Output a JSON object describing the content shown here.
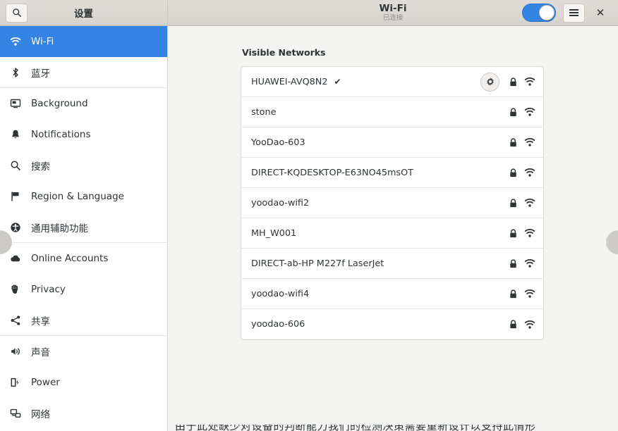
{
  "window": {
    "headerbar": {
      "sidebar_title": "设置",
      "search_icon": "search-icon",
      "title": "Wi-Fi",
      "subtitle": "已连接",
      "wifi_toggle_state": "on",
      "menu_icon": "hamburger-menu-icon",
      "close_label": "✕",
      "accent_color": "#3584e4"
    },
    "sidebar": {
      "items": [
        {
          "label": "Wi-Fi",
          "icon": "wifi-icon",
          "selected": true,
          "separator_after": false
        },
        {
          "label": "蓝牙",
          "icon": "bluetooth-icon",
          "selected": false,
          "separator_after": true
        },
        {
          "label": "Background",
          "icon": "background-icon",
          "selected": false,
          "separator_after": false
        },
        {
          "label": "Notifications",
          "icon": "bell-icon",
          "selected": false,
          "separator_after": false
        },
        {
          "label": "搜索",
          "icon": "search-icon",
          "selected": false,
          "separator_after": false
        },
        {
          "label": "Region & Language",
          "icon": "flag-icon",
          "selected": false,
          "separator_after": false
        },
        {
          "label": "通用辅助功能",
          "icon": "accessibility-icon",
          "selected": false,
          "separator_after": true
        },
        {
          "label": "Online Accounts",
          "icon": "cloud-icon",
          "selected": false,
          "separator_after": false
        },
        {
          "label": "Privacy",
          "icon": "hand-icon",
          "selected": false,
          "separator_after": false
        },
        {
          "label": "共享",
          "icon": "share-icon",
          "selected": false,
          "separator_after": true
        },
        {
          "label": "声音",
          "icon": "sound-icon",
          "selected": false,
          "separator_after": false
        },
        {
          "label": "Power",
          "icon": "power-battery-icon",
          "selected": false,
          "separator_after": false
        },
        {
          "label": "网络",
          "icon": "network-icon",
          "selected": false,
          "separator_after": false
        }
      ]
    },
    "content": {
      "section_title": "Visible Networks",
      "networks": [
        {
          "ssid": "HUAWEI-AVQ8N2",
          "connected": true,
          "check": "✔",
          "has_settings_button": true,
          "secured": true,
          "signal_icon": "wifi-signal-icon"
        },
        {
          "ssid": "stone",
          "connected": false,
          "check": "",
          "has_settings_button": false,
          "secured": true,
          "signal_icon": "wifi-signal-icon"
        },
        {
          "ssid": "YooDao-603",
          "connected": false,
          "check": "",
          "has_settings_button": false,
          "secured": true,
          "signal_icon": "wifi-signal-icon"
        },
        {
          "ssid": "DIRECT-KQDESKTOP-E63NO45msOT",
          "connected": false,
          "check": "",
          "has_settings_button": false,
          "secured": true,
          "signal_icon": "wifi-signal-icon"
        },
        {
          "ssid": "yoodao-wifi2",
          "connected": false,
          "check": "",
          "has_settings_button": false,
          "secured": true,
          "signal_icon": "wifi-signal-icon"
        },
        {
          "ssid": "MH_W001",
          "connected": false,
          "check": "",
          "has_settings_button": false,
          "secured": true,
          "signal_icon": "wifi-signal-icon"
        },
        {
          "ssid": "DIRECT-ab-HP M227f LaserJet",
          "connected": false,
          "check": "",
          "has_settings_button": false,
          "secured": true,
          "signal_icon": "wifi-signal-icon"
        },
        {
          "ssid": "yoodao-wifi4",
          "connected": false,
          "check": "",
          "has_settings_button": false,
          "secured": true,
          "signal_icon": "wifi-signal-icon"
        },
        {
          "ssid": "yoodao-606",
          "connected": false,
          "check": "",
          "has_settings_button": false,
          "secured": true,
          "signal_icon": "wifi-signal-icon"
        }
      ],
      "annotation": {
        "target": "wifi-settings-gear-button",
        "color": "#ee1111"
      },
      "bottom_clipped_text": "由于此处缺少对设备的判断能力我们的检测决策需要重新设计以支持此情形"
    }
  }
}
